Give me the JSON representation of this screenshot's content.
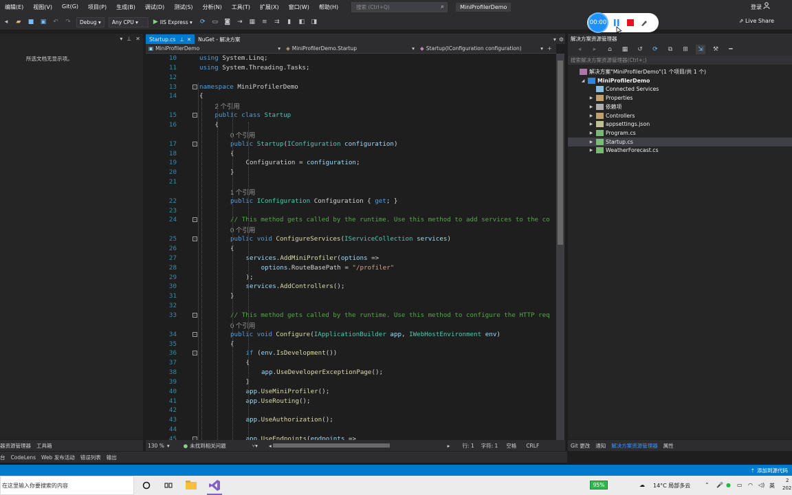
{
  "menubar": {
    "items": [
      "编辑(E)",
      "视图(V)",
      "Git(G)",
      "项目(P)",
      "生成(B)",
      "调试(D)",
      "测试(S)",
      "分析(N)",
      "工具(T)",
      "扩展(X)",
      "窗口(W)",
      "帮助(H)"
    ],
    "search_placeholder": "搜索 (Ctrl+Q)",
    "app_name": "MiniProfilerDemo",
    "login": "登录"
  },
  "toolbar": {
    "config": "Debug",
    "platform": "Any CPU",
    "run_label": "IIS Express",
    "live_share": "Live Share"
  },
  "recorder": {
    "time": "00:00"
  },
  "left_panel": {
    "empty_text": "所选文档无显示项。",
    "bottom_tabs": [
      "器资源管理器",
      "工具箱"
    ]
  },
  "bottom_tabs": [
    "台",
    "CodeLens",
    "Web 发布活动",
    "错误列表",
    "输出"
  ],
  "editor": {
    "tabs": [
      {
        "label": "Startup.cs",
        "active": true
      },
      {
        "label": "NuGet - 解决方案",
        "active": false
      }
    ],
    "nav": [
      "MiniProfilerDemo",
      "MiniProfilerDemo.Startup",
      "Startup(IConfiguration configuration)"
    ],
    "lines": [
      {
        "n": "10",
        "html": "<span class='kw'>using</span> System.Linq;",
        "indent": 0
      },
      {
        "n": "11",
        "html": "<span class='kw'>using</span> System.Threading.Tasks;",
        "indent": 0
      },
      {
        "n": "12",
        "html": "",
        "indent": 0
      },
      {
        "n": "13",
        "html": "<span class='kw'>namespace</span> MiniProfilerDemo",
        "indent": 0,
        "fold": true
      },
      {
        "n": "14",
        "html": "{",
        "indent": 0
      },
      {
        "n": "15",
        "html": "<span class='kw'>public class</span> <span class='ty'>Startup</span>",
        "indent": 1,
        "fold": true,
        "lens": "2 个引用"
      },
      {
        "n": "16",
        "html": "{",
        "indent": 1
      },
      {
        "n": "17",
        "html": "<span class='kw'>public</span> <span class='ty'>Startup</span>(<span class='ty'>IConfiguration</span> <span class='id'>configuration</span>)",
        "indent": 2,
        "fold": true,
        "lens": "0 个引用"
      },
      {
        "n": "18",
        "html": "{",
        "indent": 2
      },
      {
        "n": "19",
        "html": "Configuration = <span class='id'>configuration</span>;",
        "indent": 3
      },
      {
        "n": "20",
        "html": "}",
        "indent": 2
      },
      {
        "n": "21",
        "html": "",
        "indent": 0
      },
      {
        "n": "22",
        "html": "<span class='kw'>public</span> <span class='ty'>IConfiguration</span> Configuration { <span class='kw'>get</span>; }",
        "indent": 2,
        "lens": "1 个引用"
      },
      {
        "n": "23",
        "html": "",
        "indent": 0
      },
      {
        "n": "24",
        "html": "<span class='cm'>// This method gets called by the runtime. Use this method to add services to the co</span>",
        "indent": 2,
        "fold": true
      },
      {
        "n": "25",
        "html": "<span class='kw'>public void</span> <span class='fn'>ConfigureServices</span>(<span class='ty'>IServiceCollection</span> <span class='id'>services</span>)",
        "indent": 2,
        "fold": true,
        "lens": "0 个引用"
      },
      {
        "n": "26",
        "html": "{",
        "indent": 2
      },
      {
        "n": "27",
        "html": "<span class='id'>services</span>.<span class='fn'>AddMiniProfiler</span>(<span class='id'>options</span> =>",
        "indent": 3
      },
      {
        "n": "28",
        "html": "    <span class='id'>options</span>.RouteBasePath = <span class='st'>\"/profiler\"</span>",
        "indent": 3
      },
      {
        "n": "29",
        "html": ");",
        "indent": 3
      },
      {
        "n": "30",
        "html": "<span class='id'>services</span>.<span class='fn'>AddControllers</span>();",
        "indent": 3
      },
      {
        "n": "31",
        "html": "}",
        "indent": 2
      },
      {
        "n": "32",
        "html": "",
        "indent": 0
      },
      {
        "n": "33",
        "html": "<span class='cm'>// This method gets called by the runtime. Use this method to configure the HTTP req</span>",
        "indent": 2,
        "fold": true
      },
      {
        "n": "34",
        "html": "<span class='kw'>public void</span> <span class='fn'>Configure</span>(<span class='ty'>IApplicationBuilder</span> <span class='id'>app</span>, <span class='ty'>IWebHostEnvironment</span> <span class='id'>env</span>)",
        "indent": 2,
        "fold": true,
        "lens": "0 个引用"
      },
      {
        "n": "35",
        "html": "{",
        "indent": 2
      },
      {
        "n": "36",
        "html": "<span class='kw'>if</span> (<span class='id'>env</span>.<span class='fn'>IsDevelopment</span>())",
        "indent": 3,
        "fold": true
      },
      {
        "n": "37",
        "html": "{",
        "indent": 3
      },
      {
        "n": "38",
        "html": "<span class='id'>app</span>.<span class='fn'>UseDeveloperExceptionPage</span>();",
        "indent": 4
      },
      {
        "n": "39",
        "html": "}",
        "indent": 3
      },
      {
        "n": "40",
        "html": "<span class='id'>app</span>.<span class='fn'>UseMiniProfiler</span>();",
        "indent": 3
      },
      {
        "n": "41",
        "html": "<span class='id'>app</span>.<span class='fn'>UseRouting</span>();",
        "indent": 3
      },
      {
        "n": "42",
        "html": "",
        "indent": 0
      },
      {
        "n": "43",
        "html": "<span class='id'>app</span>.<span class='fn'>UseAuthorization</span>();",
        "indent": 3
      },
      {
        "n": "44",
        "html": "",
        "indent": 0
      },
      {
        "n": "45",
        "html": "<span class='id'>app</span>.<span class='fn'>UseEndpoints</span>(<span class='id'>endpoints</span> =>",
        "indent": 3,
        "fold": true
      }
    ],
    "status": {
      "zoom": "130 %",
      "issues": "未找到相关问题",
      "line": "行: 1",
      "char": "字符: 1",
      "spaces": "空格",
      "eol": "CRLF"
    }
  },
  "solution_explorer": {
    "title": "解决方案资源管理器",
    "search_placeholder": "搜索解决方案资源管理器(Ctrl+;)",
    "items": [
      {
        "label": "解决方案\"MiniProfilerDemo\"(1 个项目/共 1 个)",
        "level": 0,
        "arrow": "",
        "icon": "solution",
        "bold": false
      },
      {
        "label": "MiniProfilerDemo",
        "level": 1,
        "arrow": "down",
        "icon": "project",
        "bold": true
      },
      {
        "label": "Connected Services",
        "level": 2,
        "arrow": "",
        "icon": "connected",
        "bold": false
      },
      {
        "label": "Properties",
        "level": 2,
        "arrow": "right",
        "icon": "folder",
        "bold": false
      },
      {
        "label": "依赖项",
        "level": 2,
        "arrow": "right",
        "icon": "deps",
        "bold": false
      },
      {
        "label": "Controllers",
        "level": 2,
        "arrow": "right",
        "icon": "folder",
        "bold": false
      },
      {
        "label": "appsettings.json",
        "level": 2,
        "arrow": "right",
        "icon": "json",
        "bold": false
      },
      {
        "label": "Program.cs",
        "level": 2,
        "arrow": "right",
        "icon": "cs",
        "bold": false
      },
      {
        "label": "Startup.cs",
        "level": 2,
        "arrow": "right",
        "icon": "cs",
        "bold": false,
        "selected": true
      },
      {
        "label": "WeatherForecast.cs",
        "level": 2,
        "arrow": "right",
        "icon": "cs",
        "bold": false
      }
    ],
    "bottom_tabs": [
      {
        "label": "Git 更改",
        "active": false
      },
      {
        "label": "通知",
        "active": false
      },
      {
        "label": "解决方案资源管理器",
        "active": true
      },
      {
        "label": "属性",
        "active": false
      }
    ]
  },
  "statusbar": {
    "right": "添加到源代码"
  },
  "taskbar": {
    "search_text": "在这里输入你要搜索的内容",
    "battery": "95%",
    "weather": "14°C 局部多云",
    "ime": "英",
    "clock_top": "2",
    "clock_bottom": "202"
  },
  "colors": {
    "accent": "#007acc",
    "record_red": "#e81123",
    "recorder_blue": "#1e90ff"
  }
}
